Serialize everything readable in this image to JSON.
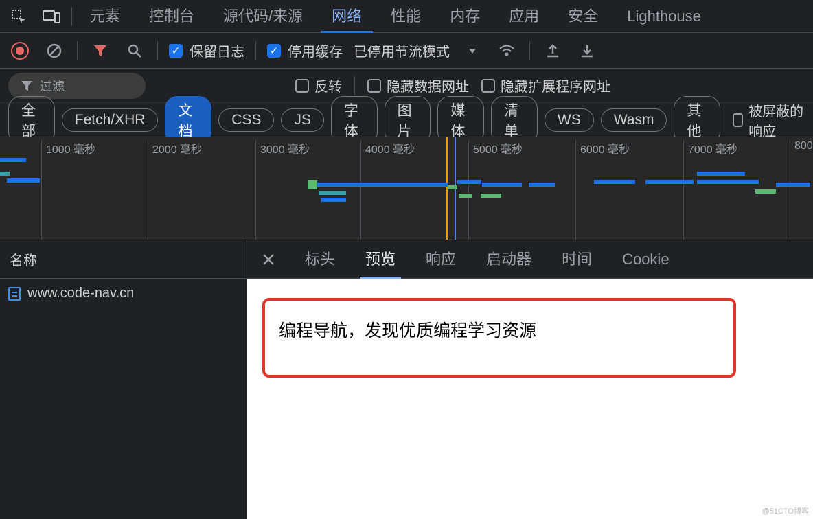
{
  "main_tabs": {
    "elements": "元素",
    "console": "控制台",
    "sources": "源代码/来源",
    "network": "网络",
    "performance": "性能",
    "memory": "内存",
    "application": "应用",
    "security": "安全",
    "lighthouse": "Lighthouse"
  },
  "toolbar": {
    "preserve_log": "保留日志",
    "disable_cache": "停用缓存",
    "throttling": "已停用节流模式"
  },
  "filter": {
    "placeholder": "过滤",
    "invert": "反转",
    "hide_data_urls": "隐藏数据网址",
    "hide_extension_urls": "隐藏扩展程序网址"
  },
  "chips": {
    "all": "全部",
    "fetch": "Fetch/XHR",
    "doc": "文档",
    "css": "CSS",
    "js": "JS",
    "font": "字体",
    "img": "图片",
    "media": "媒体",
    "manifest": "清单",
    "ws": "WS",
    "wasm": "Wasm",
    "other": "其他",
    "blocked": "被屏蔽的响应"
  },
  "ticks": {
    "t1": "1000 毫秒",
    "t2": "2000 毫秒",
    "t3": "3000 毫秒",
    "t4": "4000 毫秒",
    "t5": "5000 毫秒",
    "t6": "6000 毫秒",
    "t7": "7000 毫秒",
    "t8": "800"
  },
  "left": {
    "name_header": "名称",
    "request1": "www.code-nav.cn"
  },
  "detail_tabs": {
    "headers": "标头",
    "preview": "预览",
    "response": "响应",
    "initiator": "启动器",
    "timing": "时间",
    "cookies": "Cookie"
  },
  "preview": {
    "text": "编程导航，发现优质编程学习资源"
  },
  "watermark": "@51CTO博客"
}
